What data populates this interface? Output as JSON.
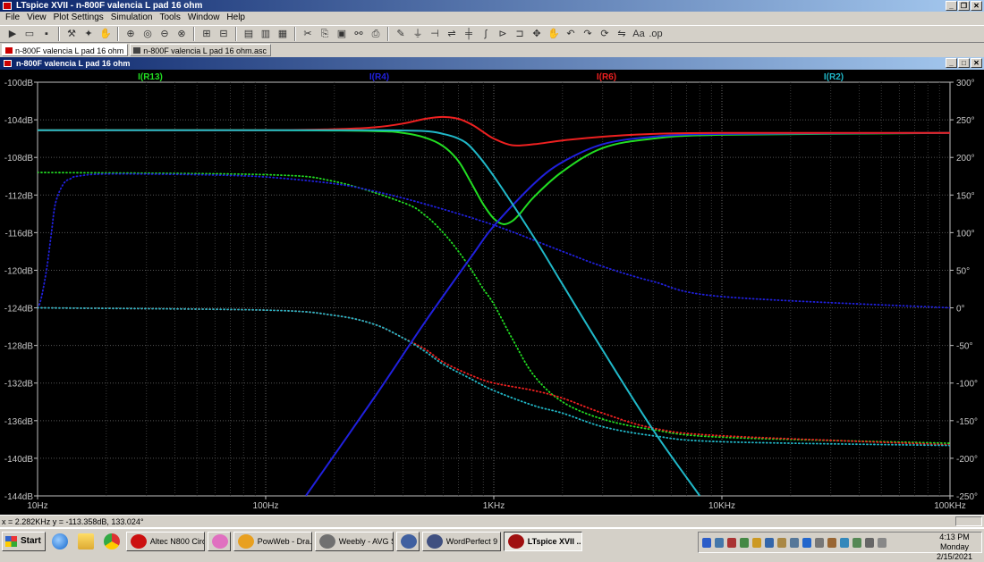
{
  "app": {
    "title": "LTspice XVII - n-800F valencia L pad 16 ohm",
    "menu": [
      "File",
      "View",
      "Plot Settings",
      "Simulation",
      "Tools",
      "Window",
      "Help"
    ],
    "tabs": [
      {
        "label": "n-800F valencia L pad 16 ohm",
        "active": true
      },
      {
        "label": "n-800F valencia L pad 16 ohm.asc",
        "active": false
      }
    ],
    "subwindow_title": "n-800F valencia L pad 16 ohm",
    "status_text": "x = 2.282KHz   y = -113.358dB, 133.024°"
  },
  "taskbar": {
    "start_label": "Start",
    "items": [
      {
        "label": "Altec N800 Circ...",
        "color": "#cc1010",
        "active": false
      },
      {
        "label": "",
        "color": "#e070c0",
        "active": false
      },
      {
        "label": "PowWeb - Dra...",
        "color": "#e8a020",
        "active": false
      },
      {
        "label": "Weebly - AVG S...",
        "color": "#707070",
        "active": false
      },
      {
        "label": "",
        "color": "#4060a0",
        "active": false
      },
      {
        "label": "WordPerfect 9 ...",
        "color": "#405080",
        "active": false
      },
      {
        "label": "LTspice XVII ...",
        "color": "#a01010",
        "active": true
      }
    ],
    "clock_time": "4:13 PM",
    "clock_day": "Monday",
    "clock_date": "2/15/2021"
  },
  "chart_data": {
    "type": "line",
    "x_scale": "log",
    "xlim": [
      10,
      100000
    ],
    "x_ticks": [
      {
        "value": 10,
        "label": "10Hz"
      },
      {
        "value": 100,
        "label": "100Hz"
      },
      {
        "value": 1000,
        "label": "1KHz"
      },
      {
        "value": 10000,
        "label": "10KHz"
      },
      {
        "value": 100000,
        "label": "100KHz"
      }
    ],
    "y_left_label_unit": "dB",
    "ylim_left": [
      -144,
      -100
    ],
    "y_left_ticks": [
      "-100dB",
      "-104dB",
      "-108dB",
      "-112dB",
      "-116dB",
      "-120dB",
      "-124dB",
      "-128dB",
      "-132dB",
      "-136dB",
      "-140dB",
      "-144dB"
    ],
    "ylim_right": [
      -250,
      300
    ],
    "y_right_ticks": [
      "300°",
      "250°",
      "200°",
      "150°",
      "100°",
      "50°",
      "0°",
      "-50°",
      "-100°",
      "-150°",
      "-200°",
      "-250°"
    ],
    "grid": true,
    "legend": [
      "I(R13)",
      "I(R4)",
      "I(R6)",
      "I(R2)"
    ],
    "series": [
      {
        "name": "I(R13)",
        "color": "#22dd22",
        "kind": "magnitude",
        "x": [
          10,
          100,
          300,
          400,
          500,
          600,
          700,
          800,
          900,
          1000,
          1100,
          1200,
          1300,
          1500,
          2000,
          3000,
          5000,
          10000,
          100000
        ],
        "y": [
          -105.1,
          -105.1,
          -105.2,
          -105.4,
          -105.9,
          -106.8,
          -108.4,
          -110.8,
          -113.0,
          -114.5,
          -115.1,
          -114.8,
          -114.0,
          -112.2,
          -109.5,
          -107.0,
          -106.0,
          -105.6,
          -105.4
        ]
      },
      {
        "name": "I(R4)",
        "color": "#2020dd",
        "kind": "magnitude",
        "x": [
          150,
          300,
          500,
          800,
          1000,
          1500,
          2000,
          3000,
          5000,
          10000,
          100000
        ],
        "y": [
          -144.0,
          -133.5,
          -125.5,
          -118.5,
          -115.3,
          -110.8,
          -108.5,
          -106.6,
          -105.8,
          -105.5,
          -105.4
        ]
      },
      {
        "name": "I(R6)",
        "color": "#ee2020",
        "kind": "magnitude",
        "x": [
          10,
          100,
          200,
          300,
          400,
          500,
          600,
          700,
          800,
          900,
          1000,
          1200,
          1500,
          2000,
          3000,
          5000,
          10000,
          100000
        ],
        "y": [
          -105.1,
          -105.1,
          -105.0,
          -104.8,
          -104.4,
          -103.9,
          -103.7,
          -103.9,
          -104.5,
          -105.3,
          -106.0,
          -106.7,
          -106.6,
          -106.2,
          -105.8,
          -105.5,
          -105.4,
          -105.4
        ]
      },
      {
        "name": "I(R2)",
        "color": "#20b8c8",
        "kind": "magnitude",
        "x": [
          10,
          100,
          300,
          500,
          600,
          700,
          800,
          1000,
          1500,
          2000,
          3000,
          5000,
          8000
        ],
        "y": [
          -105.1,
          -105.1,
          -105.1,
          -105.2,
          -105.5,
          -106.0,
          -107.0,
          -110.0,
          -116.5,
          -121.5,
          -128.5,
          -137.0,
          -144.0
        ]
      },
      {
        "name": "I(R13) phase",
        "color": "#22dd22",
        "kind": "phase",
        "dotted": true,
        "x": [
          10,
          100,
          200,
          400,
          500,
          600,
          700,
          800,
          900,
          1000,
          1200,
          1500,
          2000,
          3000,
          5000,
          10000,
          100000
        ],
        "y": [
          180,
          177,
          168,
          140,
          123,
          100,
          75,
          50,
          25,
          5,
          -40,
          -90,
          -125,
          -148,
          -162,
          -172,
          -180
        ]
      },
      {
        "name": "I(R4) phase",
        "color": "#2020dd",
        "kind": "phase",
        "dotted": true,
        "x": [
          10,
          10.2,
          10.5,
          11,
          11.5,
          12,
          13,
          14,
          15,
          20,
          50,
          100,
          200,
          300,
          500,
          1000,
          2000,
          3000,
          5000,
          10000,
          100000
        ],
        "y": [
          0,
          5,
          20,
          55,
          100,
          140,
          165,
          172,
          175,
          178,
          177,
          174,
          165,
          155,
          138,
          110,
          75,
          55,
          35,
          15,
          0
        ]
      },
      {
        "name": "I(R6) phase",
        "color": "#ee2020",
        "kind": "phase",
        "dotted": true,
        "x": [
          10,
          100,
          200,
          300,
          400,
          500,
          600,
          800,
          1000,
          1500,
          2000,
          3000,
          5000,
          10000,
          100000
        ],
        "y": [
          0,
          -3,
          -10,
          -22,
          -40,
          -55,
          -72,
          -90,
          -100,
          -110,
          -120,
          -140,
          -160,
          -170,
          -182
        ]
      },
      {
        "name": "I(R2) phase",
        "color": "#20b8c8",
        "kind": "phase",
        "dotted": true,
        "x": [
          10,
          100,
          200,
          300,
          400,
          500,
          600,
          800,
          1000,
          1500,
          2000,
          3000,
          5000,
          10000,
          100000
        ],
        "y": [
          0,
          -3,
          -10,
          -22,
          -40,
          -58,
          -75,
          -95,
          -110,
          -130,
          -140,
          -158,
          -170,
          -178,
          -183
        ]
      }
    ]
  }
}
